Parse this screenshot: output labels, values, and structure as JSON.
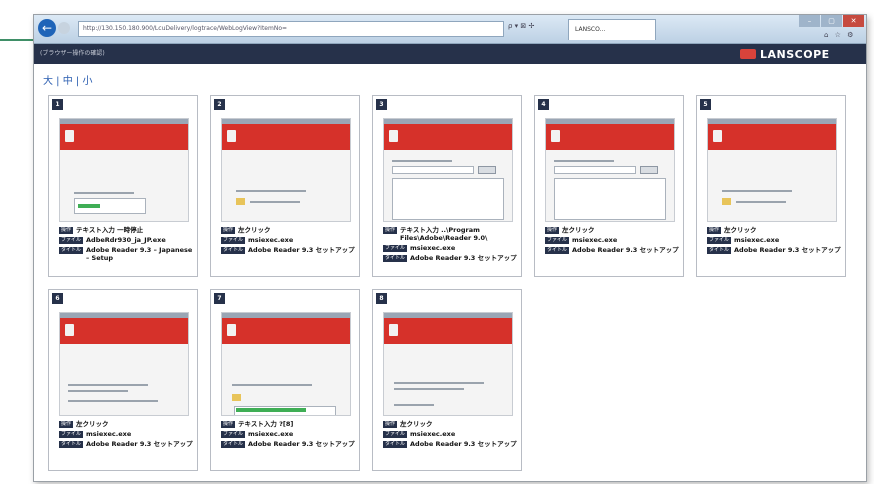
{
  "browser": {
    "address": "http://130.150.180.900/LcuDelivery/logtrace/WebLogView?ItemNo=",
    "address_icons": "ρ ▾ ⊠ ✢",
    "tab_label": "LANSCO...",
    "window_controls": [
      "–",
      "▢",
      "✕"
    ],
    "toolbar_icons": "⌂ ☆ ⚙"
  },
  "app": {
    "title": "(ブラウザー操作の確認)",
    "logo_text": "LANSCOPE",
    "size_links": "大 | 中 | 小"
  },
  "steps": [
    {
      "num": "1",
      "rows": [
        {
          "tag": "操作",
          "value": "テキスト入力 一時停止"
        },
        {
          "tag": "ファイル",
          "value": "AdbeRdr930_ja_JP.exe"
        },
        {
          "tag": "タイトル",
          "value": "Adobe Reader 9.3 – Japanese – Setup"
        }
      ]
    },
    {
      "num": "2",
      "rows": [
        {
          "tag": "操作",
          "value": "左クリック"
        },
        {
          "tag": "ファイル",
          "value": "msiexec.exe"
        },
        {
          "tag": "タイトル",
          "value": "Adobe Reader 9.3 セットアップ"
        }
      ]
    },
    {
      "num": "3",
      "rows": [
        {
          "tag": "操作",
          "value": "テキスト入力 ..\\Program Files\\Adobe\\Reader 9.0\\"
        },
        {
          "tag": "ファイル",
          "value": "msiexec.exe"
        },
        {
          "tag": "タイトル",
          "value": "Adobe Reader 9.3 セットアップ"
        }
      ]
    },
    {
      "num": "4",
      "rows": [
        {
          "tag": "操作",
          "value": "左クリック"
        },
        {
          "tag": "ファイル",
          "value": "msiexec.exe"
        },
        {
          "tag": "タイトル",
          "value": "Adobe Reader 9.3 セットアップ"
        }
      ]
    },
    {
      "num": "5",
      "rows": [
        {
          "tag": "操作",
          "value": "左クリック"
        },
        {
          "tag": "ファイル",
          "value": "msiexec.exe"
        },
        {
          "tag": "タイトル",
          "value": "Adobe Reader 9.3 セットアップ"
        }
      ]
    },
    {
      "num": "6",
      "rows": [
        {
          "tag": "操作",
          "value": "左クリック"
        },
        {
          "tag": "ファイル",
          "value": "msiexec.exe"
        },
        {
          "tag": "タイトル",
          "value": "Adobe Reader 9.3 セットアップ"
        }
      ]
    },
    {
      "num": "7",
      "rows": [
        {
          "tag": "操作",
          "value": "テキスト入力 ?[8]"
        },
        {
          "tag": "ファイル",
          "value": "msiexec.exe"
        },
        {
          "tag": "タイトル",
          "value": "Adobe Reader 9.3 セットアップ"
        }
      ]
    },
    {
      "num": "8",
      "rows": [
        {
          "tag": "操作",
          "value": "左クリック"
        },
        {
          "tag": "ファイル",
          "value": "msiexec.exe"
        },
        {
          "tag": "タイトル",
          "value": "Adobe Reader 9.3 セットアップ"
        }
      ]
    }
  ],
  "colors": {
    "header": "#26314a",
    "accent": "#d6312a",
    "progress": "#3fae55",
    "callout": "#3f8f67"
  }
}
